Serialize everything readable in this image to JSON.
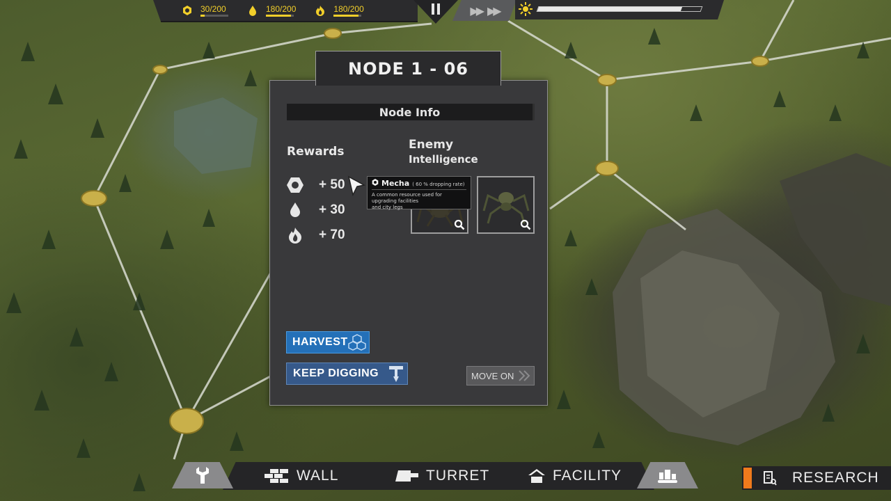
{
  "hud": {
    "resources": [
      {
        "icon": "mecha-icon",
        "count": "30/200",
        "fill": 0.15
      },
      {
        "icon": "water-drop-icon",
        "count": "180/200",
        "fill": 0.9
      },
      {
        "icon": "fire-icon",
        "count": "180/200",
        "fill": 0.9
      }
    ],
    "day_progress": 0.88,
    "colors": {
      "resource": "#f2cf2a",
      "panel": "#39393b",
      "harvest": "#2470b8",
      "dig": "#36598a",
      "research_accent": "#f07a1c"
    }
  },
  "node": {
    "title": "NODE 1 - 06",
    "info_header": "Node Info",
    "rewards_title": "Rewards",
    "rewards": [
      {
        "icon": "mecha-icon",
        "value": "+ 50"
      },
      {
        "icon": "water-drop-icon",
        "value": "+ 30"
      },
      {
        "icon": "fire-icon",
        "value": "+ 70"
      }
    ],
    "enemy_title_line1": "Enemy",
    "enemy_title_line2": "Intelligence"
  },
  "tooltip": {
    "name": "Mecha",
    "rate": "( 60 % dropping rate)",
    "description_line1": "A common resource used for upgrading facilities",
    "description_line2": "and city legs"
  },
  "actions": {
    "harvest": "HARVEST",
    "keep_digging": "KEEP DIGGING",
    "move_on": "MOVE ON"
  },
  "build_bar": {
    "wall": "WALL",
    "turret": "TURRET",
    "facility": "FACILITY",
    "research": "RESEARCH"
  }
}
